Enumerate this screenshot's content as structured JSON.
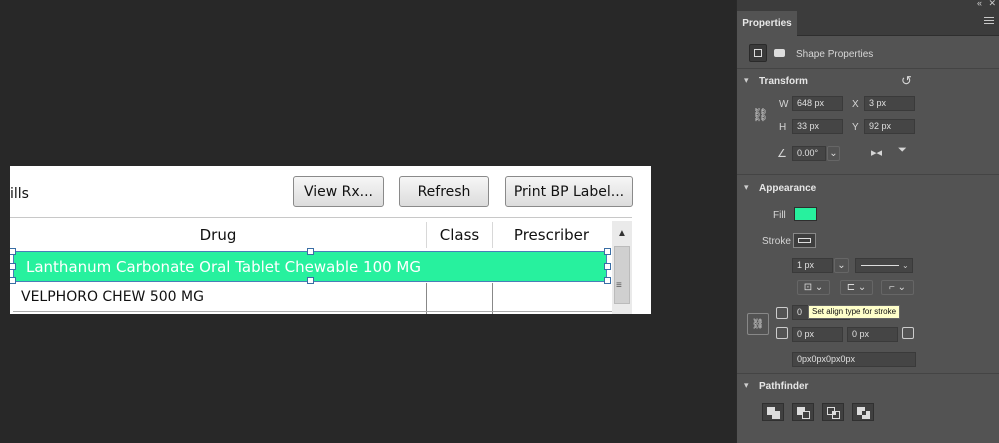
{
  "document": {
    "partial_label": "ills",
    "buttons": {
      "view_rx": "View Rx...",
      "refresh": "Refresh",
      "print_bp_label": "Print BP Label..."
    },
    "columns": [
      "Drug",
      "Class",
      "Prescriber"
    ],
    "rows": [
      {
        "drug": "Lanthanum Carbonate Oral Tablet Chewable 100 MG",
        "selected": true
      },
      {
        "drug": "VELPHORO CHEW 500 MG",
        "selected": false
      }
    ],
    "selection_color": "#27f19e"
  },
  "panel": {
    "tab": "Properties",
    "subtitle": "Shape Properties",
    "transform": {
      "title": "Transform",
      "w_label": "W",
      "w_value": "648 px",
      "x_label": "X",
      "x_value": "3 px",
      "h_label": "H",
      "h_value": "33 px",
      "y_label": "Y",
      "y_value": "92 px",
      "angle_value": "0.00°"
    },
    "appearance": {
      "title": "Appearance",
      "fill_label": "Fill",
      "fill_color": "#27f19e",
      "stroke_label": "Stroke",
      "stroke_width": "1 px",
      "corner_tl": "0",
      "corner_bl": "0 px",
      "corner_br": "0 px",
      "corner_radii": "0px0px0px0px"
    },
    "tooltip": "Set align type for stroke",
    "pathfinder": {
      "title": "Pathfinder"
    }
  }
}
